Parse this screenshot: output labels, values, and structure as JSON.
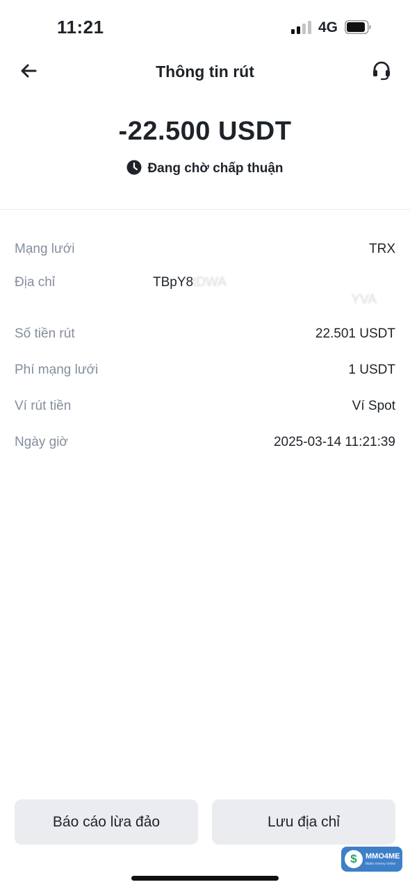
{
  "status_bar": {
    "time": "11:21",
    "network": "4G"
  },
  "header": {
    "title": "Thông tin rút"
  },
  "summary": {
    "amount": "-22.500 USDT",
    "status": "Đang chờ chấp thuận"
  },
  "details": {
    "network_label": "Mạng lưới",
    "network_value": "TRX",
    "address_label": "Địa chỉ",
    "address_visible": "TBpY8",
    "address_faded": "tDWA",
    "address_line2": "YVA",
    "amount_label": "Số tiền rút",
    "amount_value": "22.501 USDT",
    "fee_label": "Phí mạng lưới",
    "fee_value": "1 USDT",
    "wallet_label": "Ví rút tiền",
    "wallet_value": "Ví Spot",
    "datetime_label": "Ngày giờ",
    "datetime_value": "2025-03-14 11:21:39"
  },
  "actions": {
    "report_label": "Báo cáo lừa đảo",
    "save_label": "Lưu địa chỉ"
  },
  "watermark": {
    "brand": "MMO4ME",
    "tagline": "Make money online"
  },
  "colors": {
    "text": "#1e2329",
    "label": "#848e9c",
    "button_bg": "#eaecef"
  }
}
